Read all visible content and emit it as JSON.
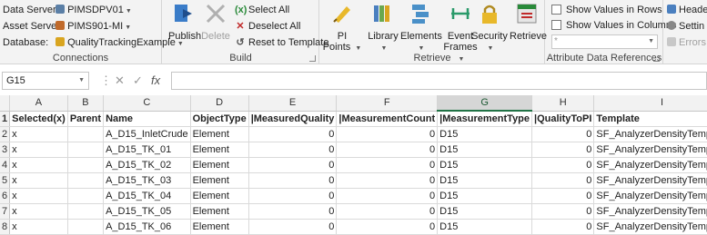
{
  "connections": {
    "data_server_label": "Data Server:",
    "data_server_value": "PIMSDPV01",
    "asset_server_label": "Asset Server:",
    "asset_server_value": "PIMS901-MI",
    "database_label": "Database:",
    "database_value": "QualityTrackingExample",
    "group_label": "Connections"
  },
  "build": {
    "publish_label": "Publish",
    "delete_label": "Delete",
    "select_all_label": "Select All",
    "deselect_all_label": "Deselect All",
    "reset_label": "Reset to Template",
    "group_label": "Build"
  },
  "retrieve": {
    "pi_points_label": "PI Points",
    "library_label": "Library",
    "elements_label": "Elements",
    "event_label": "Event",
    "frames_label": "Frames",
    "security_label": "Security",
    "retrieve_label": "Retrieve",
    "group_label": "Retrieve"
  },
  "attr": {
    "show_rows_label": "Show Values in Rows",
    "show_cols_label": "Show Values in Columns",
    "input_value": "*",
    "group_label": "Attribute Data References"
  },
  "extra": {
    "header_label": "Heade",
    "settings_label": "Settin",
    "errors_label": "Errors"
  },
  "formula_bar": {
    "cell_ref": "G15",
    "fx": "fx",
    "cancel": "✕",
    "enter": "✓"
  },
  "sheet": {
    "columns": [
      "A",
      "B",
      "C",
      "D",
      "E",
      "F",
      "G",
      "H",
      "I"
    ],
    "selected_column": "G",
    "row_numbers": [
      "1",
      "2",
      "3",
      "4",
      "5",
      "6",
      "7",
      "8"
    ],
    "header_row": [
      "Selected(x)",
      "Parent",
      "Name",
      "ObjectType",
      "|MeasuredQuality",
      "|MeasurementCount",
      "|MeasurementType",
      "|QualityToPI",
      "Template"
    ],
    "rows": [
      [
        "x",
        "",
        "A_D15_InletCrude",
        "Element",
        "0",
        "0",
        "D15",
        "0",
        "SF_AnalyzerDensityTemplate"
      ],
      [
        "x",
        "",
        "A_D15_TK_01",
        "Element",
        "0",
        "0",
        "D15",
        "0",
        "SF_AnalyzerDensityTemplate"
      ],
      [
        "x",
        "",
        "A_D15_TK_02",
        "Element",
        "0",
        "0",
        "D15",
        "0",
        "SF_AnalyzerDensityTemplate"
      ],
      [
        "x",
        "",
        "A_D15_TK_03",
        "Element",
        "0",
        "0",
        "D15",
        "0",
        "SF_AnalyzerDensityTemplate"
      ],
      [
        "x",
        "",
        "A_D15_TK_04",
        "Element",
        "0",
        "0",
        "D15",
        "0",
        "SF_AnalyzerDensityTemplate"
      ],
      [
        "x",
        "",
        "A_D15_TK_05",
        "Element",
        "0",
        "0",
        "D15",
        "0",
        "SF_AnalyzerDensityTemplate"
      ],
      [
        "x",
        "",
        "A_D15_TK_06",
        "Element",
        "0",
        "0",
        "D15",
        "0",
        "SF_AnalyzerDensityTemplate"
      ]
    ]
  }
}
